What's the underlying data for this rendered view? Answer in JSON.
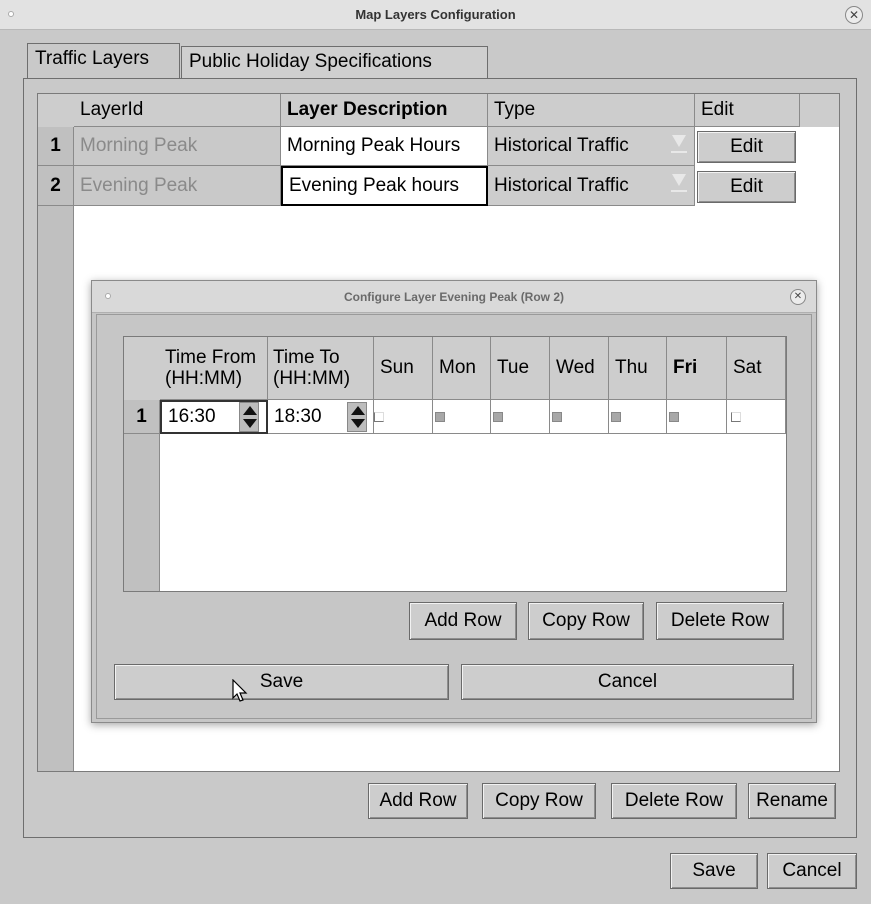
{
  "window": {
    "title": "Map Layers Configuration"
  },
  "tabs": [
    {
      "label": "Traffic Layers",
      "active": true
    },
    {
      "label": "Public Holiday Specifications",
      "active": false
    }
  ],
  "layers_table": {
    "headers": [
      "LayerId",
      "Layer Description",
      "Type",
      "Edit"
    ],
    "rows": [
      {
        "num": "1",
        "layer_id": "Morning Peak",
        "description": "Morning Peak Hours",
        "type": "Historical Traffic",
        "edit": "Edit"
      },
      {
        "num": "2",
        "layer_id": "Evening Peak",
        "description": "Evening Peak hours",
        "type": "Historical Traffic",
        "edit": "Edit"
      }
    ]
  },
  "dialog": {
    "title": "Configure Layer Evening Peak (Row 2)",
    "headers": {
      "time_from": "Time From (HH:MM)",
      "time_to": "Time To (HH:MM)",
      "days": [
        "Sun",
        "Mon",
        "Tue",
        "Wed",
        "Thu",
        "Fri",
        "Sat"
      ]
    },
    "rows": [
      {
        "num": "1",
        "time_from": "16:30",
        "time_to": "18:30",
        "days": [
          false,
          true,
          true,
          true,
          true,
          true,
          false
        ]
      }
    ],
    "buttons": {
      "add_row": "Add Row",
      "copy_row": "Copy Row",
      "delete_row": "Delete Row",
      "save": "Save",
      "cancel": "Cancel"
    }
  },
  "main_buttons": {
    "add_row": "Add Row",
    "copy_row": "Copy Row",
    "delete_row": "Delete Row",
    "rename": "Rename",
    "save": "Save",
    "cancel": "Cancel"
  }
}
